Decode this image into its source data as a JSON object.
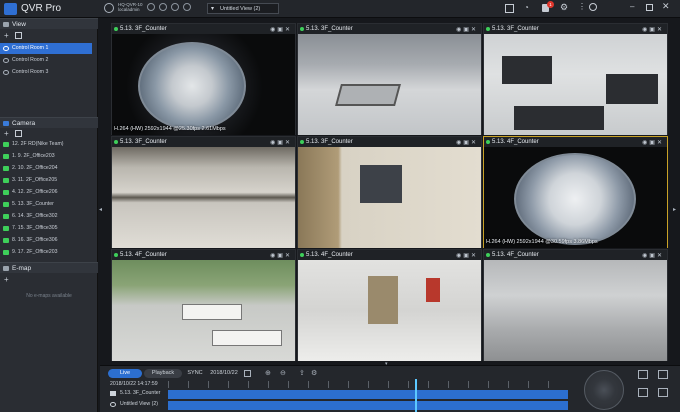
{
  "app": {
    "name": "QVR Pro"
  },
  "topbar": {
    "server_line1": "HQ-QVR-10",
    "server_line2": "localadmin",
    "status_icons": [
      "CPU",
      "RAM",
      "NET",
      "DISK"
    ],
    "view_select": "Untitled View (2)",
    "notification_count": "1"
  },
  "sidebar": {
    "view_title": "View",
    "view_items": [
      "Control Room 1",
      "Control Room 2",
      "Control Room 3"
    ],
    "camera_title": "Camera",
    "camera_items": [
      "12. 2F RD(Nike Team)",
      "1. 9. 2F_Office203",
      "2. 10. 2F_Office204",
      "3. 11. 2F_Office205",
      "4. 12. 2F_Office206",
      "5. 13. 3F_Counter",
      "6. 14. 3F_Office302",
      "7. 15. 3F_Office305",
      "8. 16. 3F_Office306",
      "9. 17. 2F_Office203"
    ],
    "emap_title": "E-map",
    "emap_empty": "No e-maps available"
  },
  "cells": [
    {
      "title": "5.13. 3F_Counter",
      "overlay": "H.264 (HW) 2592x1944 @25.30fps 2.61Mbps"
    },
    {
      "title": "5.13. 3F_Counter",
      "overlay": ""
    },
    {
      "title": "5.13. 3F_Counter",
      "overlay": ""
    },
    {
      "title": "5.13. 3F_Counter",
      "overlay": ""
    },
    {
      "title": "5.13. 3F_Counter",
      "overlay": ""
    },
    {
      "title": "5.13. 4F_Counter",
      "overlay": "H.264 (HW) 2592x1944 @30.59fps 3.86Mbps"
    },
    {
      "title": "5.13. 4F_Counter",
      "overlay": ""
    },
    {
      "title": "5.13. 4F_Counter",
      "overlay": ""
    },
    {
      "title": "5.13. 4F_Counter",
      "overlay": ""
    }
  ],
  "timeline": {
    "live_label": "Live",
    "playback_label": "Playback",
    "sync_label": "SYNC",
    "date": "2018/10/22",
    "datetime": "2018/10/22 14:17:59",
    "tracks": [
      "5.13. 3F_Counter",
      "Untitled View (2)"
    ]
  },
  "colors": {
    "accent": "#2c6fd0",
    "live_dot": "#3ecf5a",
    "selected_border": "#c9a227"
  }
}
